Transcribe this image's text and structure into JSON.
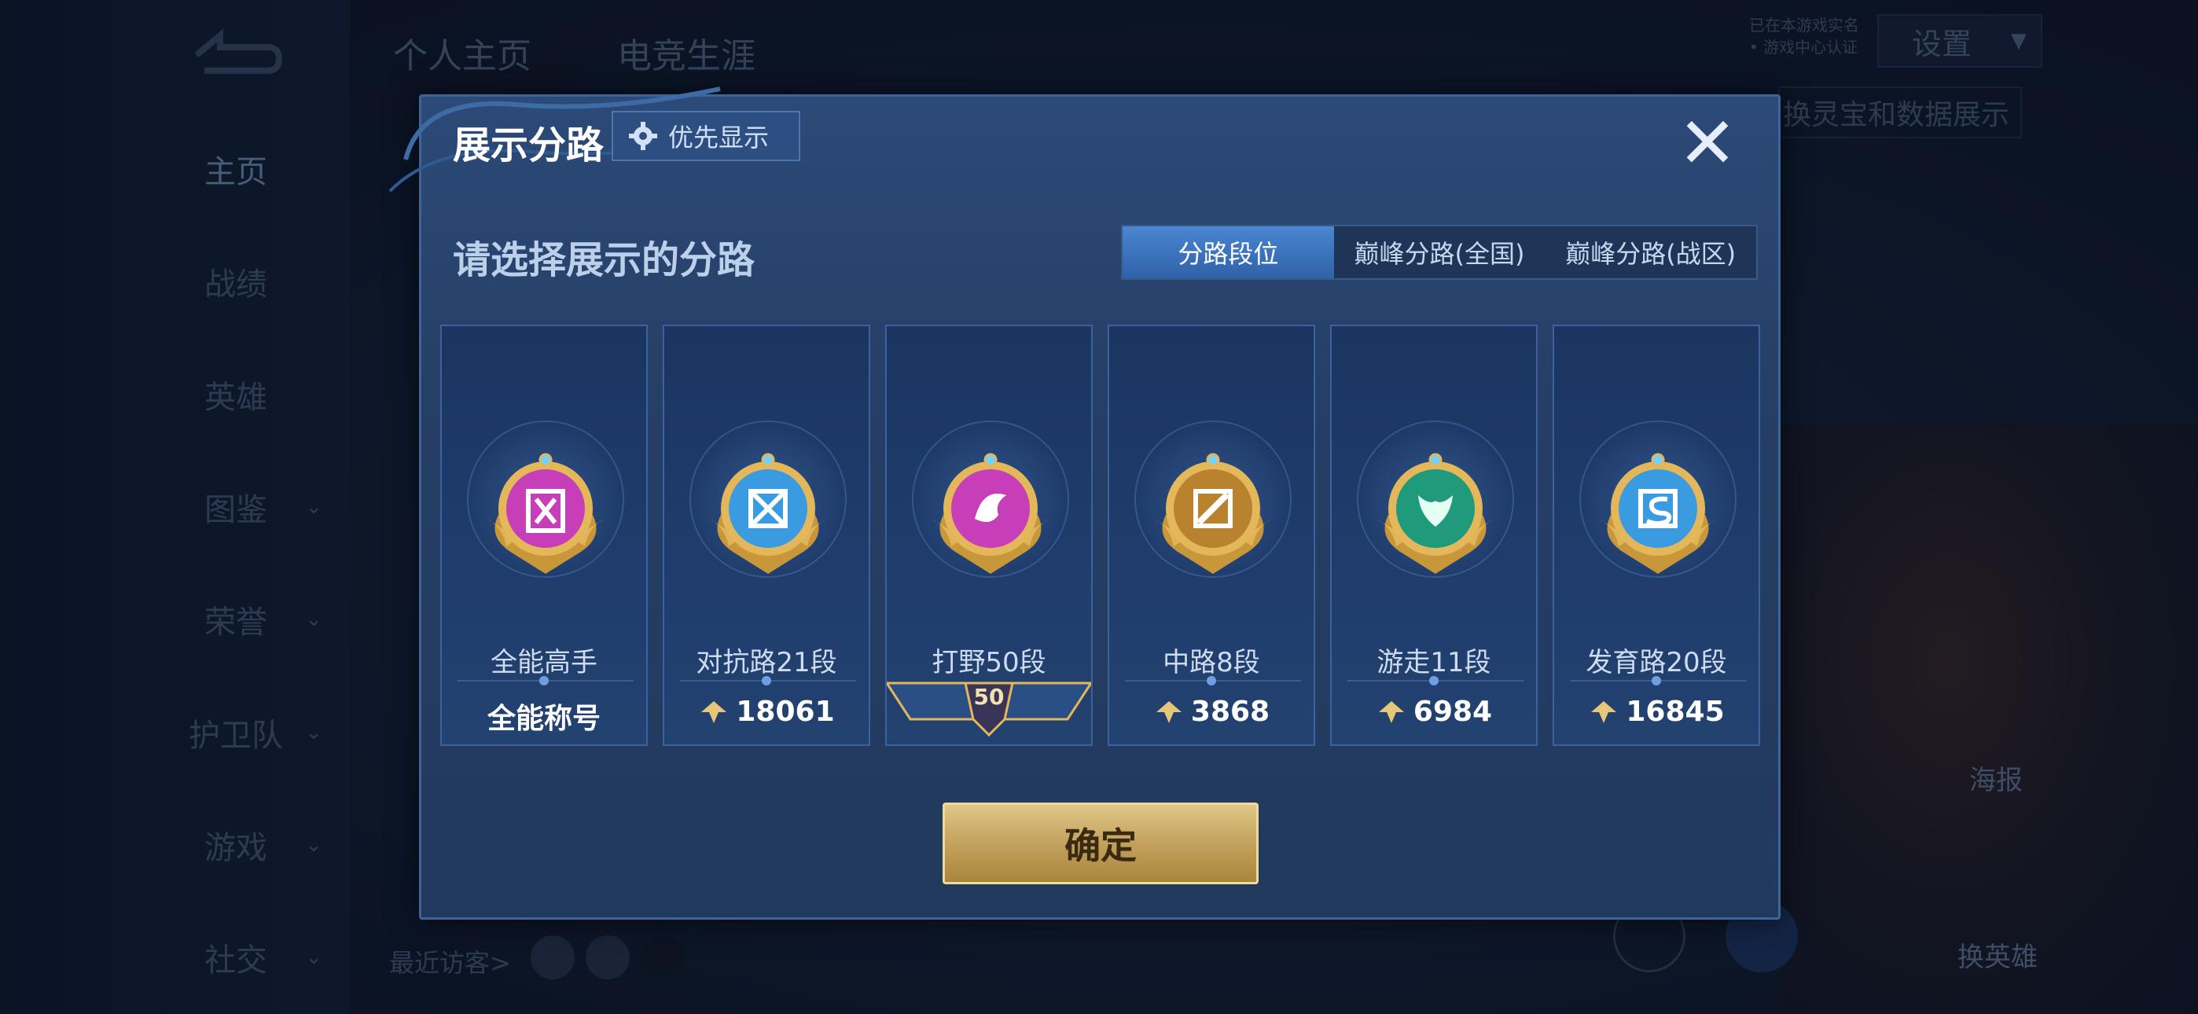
{
  "background": {
    "top_tabs": [
      "个人主页",
      "电竞生涯"
    ],
    "nav": {
      "items": [
        {
          "label": "主页",
          "chevron": false
        },
        {
          "label": "战绩",
          "chevron": false
        },
        {
          "label": "英雄",
          "chevron": false
        },
        {
          "label": "图鉴",
          "chevron": true
        },
        {
          "label": "荣誉",
          "chevron": true
        },
        {
          "label": "护卫队",
          "chevron": true
        },
        {
          "label": "游戏",
          "chevron": true
        },
        {
          "label": "社交",
          "chevron": true
        }
      ]
    },
    "realname_line1": "已在本游戏实名",
    "realname_line2": "• 游戏中心认证",
    "settings_label": "设置",
    "switch_text": "换灵宝和数据展示",
    "recent_visitors": "最近访客>",
    "poster_label": "海报",
    "switch_hero_label": "换英雄"
  },
  "dialog": {
    "title": "展示分路",
    "priority_label": "优先显示",
    "subtitle": "请选择展示的分路",
    "tabs": [
      {
        "label": "分路段位",
        "active": true
      },
      {
        "label": "巅峰分路(全国)",
        "active": false
      },
      {
        "label": "巅峰分路(战区)",
        "active": false
      }
    ],
    "cards": [
      {
        "name": "全能高手",
        "value": "全能称号",
        "has_icon": false,
        "badge": "all-round",
        "color": "#c73fb8"
      },
      {
        "name": "对抗路21段",
        "value": "18061",
        "has_icon": true,
        "badge": "clash-lane",
        "color": "#3b9be0"
      },
      {
        "name": "打野50段",
        "value": "50",
        "has_icon": false,
        "badge": "jungle",
        "color": "#c73fb8",
        "ribbon": true
      },
      {
        "name": "中路8段",
        "value": "3868",
        "has_icon": true,
        "badge": "mid-lane",
        "color": "#b9822e"
      },
      {
        "name": "游走11段",
        "value": "6984",
        "has_icon": true,
        "badge": "roam",
        "color": "#1f9a7a"
      },
      {
        "name": "发育路20段",
        "value": "16845",
        "has_icon": true,
        "badge": "farm-lane",
        "color": "#3b9be0"
      }
    ],
    "confirm_label": "确定"
  }
}
